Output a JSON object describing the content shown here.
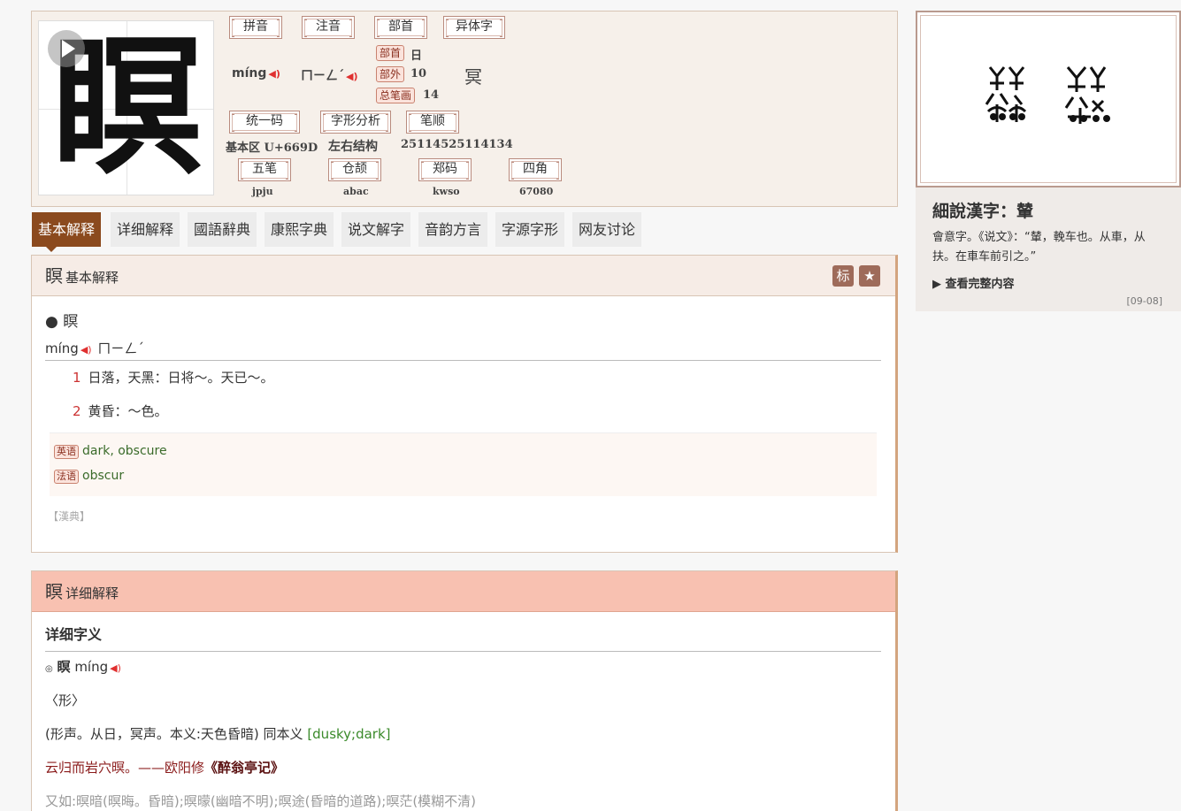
{
  "char": "瞑",
  "header": {
    "labels": {
      "pinyin": "拼音",
      "zhuyin": "注音",
      "bushou": "部首",
      "variant": "异体字",
      "unicode": "统一码",
      "structure": "字形分析",
      "stroke_order": "笔顺",
      "wubi": "五笔",
      "cangjie": "仓颉",
      "zhengma": "郑码",
      "sijiao": "四角"
    },
    "pinyin": "míng",
    "zhuyin": "ㄇㄧㄥˊ",
    "badges": {
      "radical": "部首",
      "outside": "部外",
      "total": "总笔画"
    },
    "radical": "日",
    "outside_strokes": "10",
    "total_strokes": "14",
    "variant": "冥",
    "unicode": "基本区 U+669D",
    "structure": "左右结构",
    "stroke_order": "25114525114134",
    "wubi": "jpju",
    "cangjie": "abac",
    "zhengma": "kwso",
    "sijiao": "67080"
  },
  "tabs": [
    "基本解释",
    "详细解释",
    "國語辭典",
    "康熙字典",
    "说文解字",
    "音韵方言",
    "字源字形",
    "网友讨论"
  ],
  "basic": {
    "title": "基本解释",
    "btn_mark": "标",
    "btn_star": "★",
    "bullet": "● 瞑",
    "pron": "míng",
    "pron_zhuyin": "ㄇㄧㄥˊ",
    "defs": [
      {
        "num": "1",
        "text": "日落，天黑：日将～。天已～。"
      },
      {
        "num": "2",
        "text": "黄昏：～色。"
      }
    ],
    "translations": [
      {
        "lang": "英语",
        "text": "dark, obscure"
      },
      {
        "lang": "法语",
        "text": "obscur"
      }
    ],
    "source": "【漢典】"
  },
  "detail": {
    "title": "详细解释",
    "section": "详细字义",
    "entry_mark": "◎",
    "entry_char": "瞑",
    "entry_pron": "míng",
    "pos": "〈形〉",
    "line1": "(形声。从日，冥声。本义:天色昏暗) 同本义",
    "line1_en": "[dusky;dark]",
    "quote": "云归而岩穴暝。——欧阳修",
    "quote_book": "《醉翁亭记》",
    "more": "又如:暝暗(暝晦。昏暗);暝曚(幽暗不明);暝途(昏暗的道路);暝茫(模糊不清)"
  },
  "sidebar": {
    "title": "細說漢字：輦",
    "text": "會意字。《说文》：“輦，輓车也。从車，从扶。在車车前引之。”",
    "more": "▶ 查看完整内容",
    "date": "[09-08]"
  },
  "colors": {
    "accent": "#8b4a1e",
    "speaker": "#e03030",
    "pink": "#f8c1b1"
  }
}
